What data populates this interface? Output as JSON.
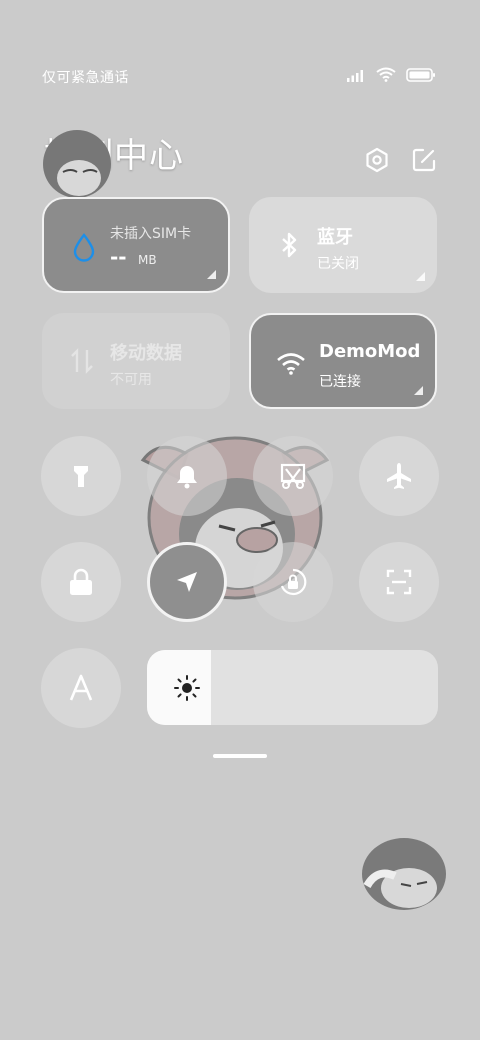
{
  "status_bar": {
    "carrier_text": "仅可紧急通话",
    "icons": [
      "signal-icon",
      "wifi-icon",
      "battery-icon"
    ]
  },
  "header": {
    "title": "控制中心",
    "settings_icon": "settings-hexagon-icon",
    "edit_icon": "edit-icon"
  },
  "tiles": {
    "data_usage": {
      "label": "未插入SIM卡",
      "value": "--",
      "unit": "MB",
      "icon": "water-drop-icon"
    },
    "bluetooth": {
      "label": "蓝牙",
      "status": "已关闭",
      "icon": "bluetooth-icon"
    },
    "mobile_data": {
      "label": "移动数据",
      "status": "不可用",
      "icon": "data-arrows-icon"
    },
    "wifi": {
      "label": "DemoMod",
      "status": "已连接",
      "icon": "wifi-icon"
    }
  },
  "toggles": [
    {
      "name": "flashlight",
      "icon": "flashlight-icon",
      "active": false
    },
    {
      "name": "bell",
      "icon": "bell-icon",
      "active": false
    },
    {
      "name": "screenshot",
      "icon": "scissors-icon",
      "active": false
    },
    {
      "name": "airplane",
      "icon": "airplane-icon",
      "active": false
    },
    {
      "name": "lock",
      "icon": "lock-icon",
      "active": false
    },
    {
      "name": "location",
      "icon": "location-arrow-icon",
      "active": true
    },
    {
      "name": "rotation-lock",
      "icon": "rotation-lock-icon",
      "active": false
    },
    {
      "name": "scan",
      "icon": "scan-icon",
      "active": false
    },
    {
      "name": "auto-brightness",
      "icon": "letter-a-icon",
      "active": false
    }
  ],
  "brightness": {
    "icon": "sun-icon",
    "level": 0.22
  },
  "colors": {
    "background": "#cbcbcb",
    "tile_active": "#8c8c8c",
    "accent_blue": "#1e8fe8"
  }
}
